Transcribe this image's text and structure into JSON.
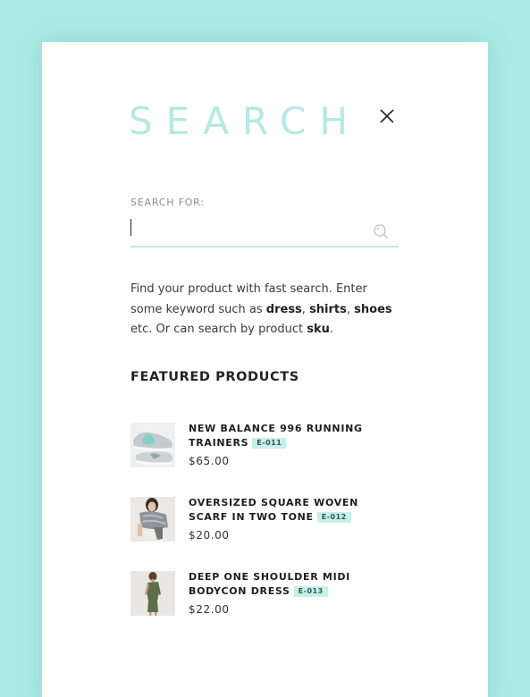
{
  "colors": {
    "background": "#abebe6",
    "panel": "#ffffff",
    "accent": "#b6e9e4",
    "badge": "#c7efea"
  },
  "header": {
    "title": "SEARCH",
    "close_icon": "close-icon"
  },
  "search": {
    "label": "SEARCH FOR:",
    "value": "",
    "icon": "search-icon"
  },
  "description": {
    "part1": "Find your product with fast search. Enter some keyword such as ",
    "kw1": "dress",
    "sep1": ", ",
    "kw2": "shirts",
    "sep2": ", ",
    "kw3": "shoes",
    "part2": " etc. Or can search by product ",
    "kw4": "sku",
    "part3": "."
  },
  "featured": {
    "heading": "FEATURED PRODUCTS",
    "products": [
      {
        "name": "NEW BALANCE 996 RUNNING TRAINERS",
        "sku": "E-011",
        "price": "$65.00"
      },
      {
        "name": "OVERSIZED SQUARE WOVEN SCARF IN TWO TONE",
        "sku": "E-012",
        "price": "$20.00"
      },
      {
        "name": "DEEP ONE SHOULDER MIDI BODYCON DRESS",
        "sku": "E-013",
        "price": "$22.00"
      }
    ]
  }
}
